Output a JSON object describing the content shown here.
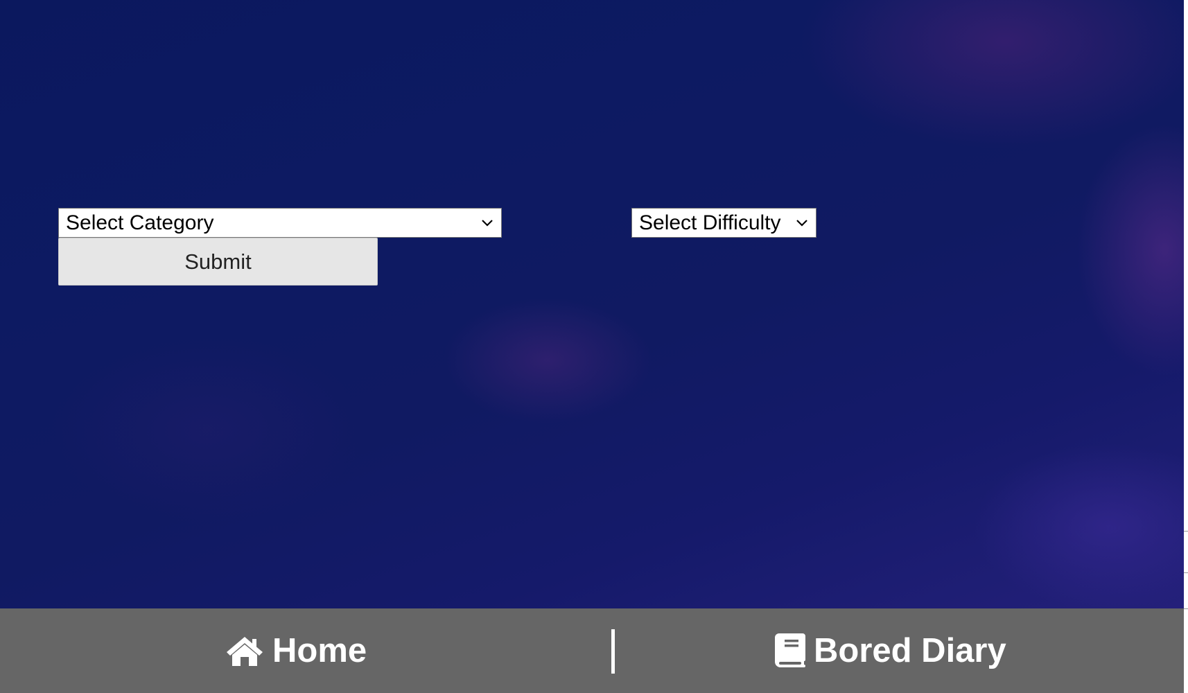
{
  "form": {
    "category_select": {
      "selected": "Select Category"
    },
    "difficulty_select": {
      "selected": "Select Difficulty"
    },
    "submit_label": "Submit"
  },
  "footer_nav": {
    "home": {
      "label": "Home",
      "icon": "home-icon"
    },
    "diary": {
      "label": "Bored Diary",
      "icon": "book-icon"
    }
  },
  "colors": {
    "background": "#0d1a62",
    "footer": "#666666",
    "nav_text": "#ffffff",
    "button": "#e6e6e6"
  }
}
